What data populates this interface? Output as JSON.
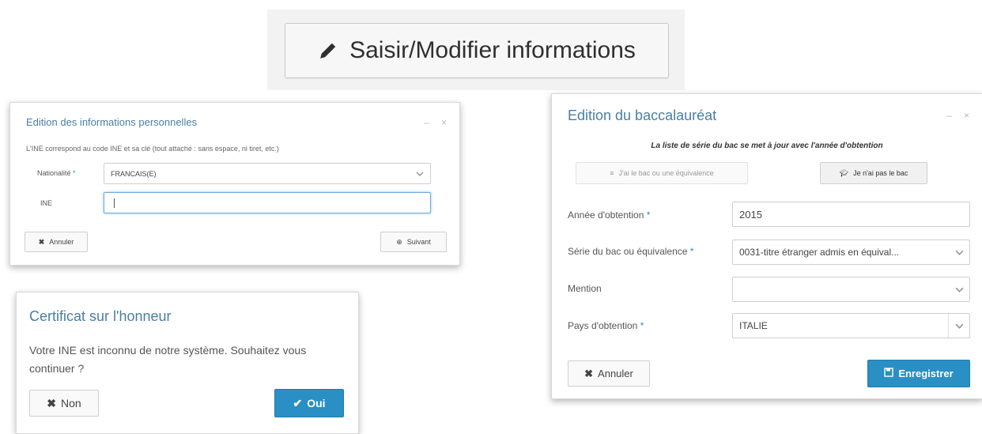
{
  "top_button": {
    "label": "Saisir/Modifier informations",
    "icon": "pencil-icon"
  },
  "personal": {
    "title": "Edition des informations personnelles",
    "controls": "– ×",
    "info": "L'INE correspond au code INE et sa clé (tout attaché : sans espace, ni tiret, etc.)",
    "nationality_label": "Nationalité",
    "nationality_value": "FRANCAIS(E)",
    "ine_label": "INE",
    "ine_value": "",
    "cancel_label": "Annuler",
    "next_label": "Suivant",
    "required_mark": "*"
  },
  "certificate": {
    "title": "Certificat sur l'honneur",
    "message": "Votre INE est inconnu de notre système. Souhaitez vous continuer ?",
    "no_label": "Non",
    "yes_label": "Oui"
  },
  "bac": {
    "title": "Edition du baccalauréat",
    "controls": "– ×",
    "subtitle": "La liste de série du bac se met à jour avec l'année d'obtention",
    "has_bac_label": "J'ai le bac ou une équivalence",
    "no_bac_label": "Je n'ai pas le bac",
    "year_label": "Année d'obtention",
    "year_value": "2015",
    "series_label": "Série du bac ou équivalence",
    "series_value": "0031-titre étranger admis en équival...",
    "mention_label": "Mention",
    "mention_value": "",
    "country_label": "Pays d'obtention",
    "country_value": "ITALIE",
    "cancel_label": "Annuler",
    "save_label": "Enregistrer",
    "required_mark": "*"
  },
  "colors": {
    "accent": "#2a8fc4",
    "title_blue": "#4a7fa3"
  }
}
